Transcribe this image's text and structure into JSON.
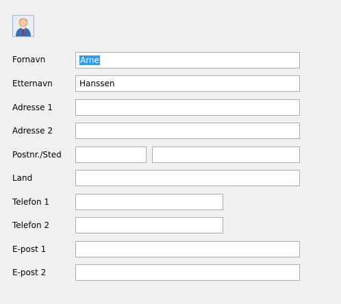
{
  "avatar": {
    "icon": "person-icon"
  },
  "fields": {
    "first_name": {
      "label": "Fornavn",
      "value": "Arne"
    },
    "last_name": {
      "label": "Etternavn",
      "value": "Hanssen"
    },
    "address1": {
      "label": "Adresse 1",
      "value": ""
    },
    "address2": {
      "label": "Adresse 2",
      "value": ""
    },
    "postal": {
      "label": "Postnr./Sted",
      "zip": "",
      "city": ""
    },
    "country": {
      "label": "Land",
      "value": ""
    },
    "phone1": {
      "label": "Telefon 1",
      "value": ""
    },
    "phone2": {
      "label": "Telefon 2",
      "value": ""
    },
    "email1": {
      "label": "E-post 1",
      "value": ""
    },
    "email2": {
      "label": "E-post 2",
      "value": ""
    }
  }
}
